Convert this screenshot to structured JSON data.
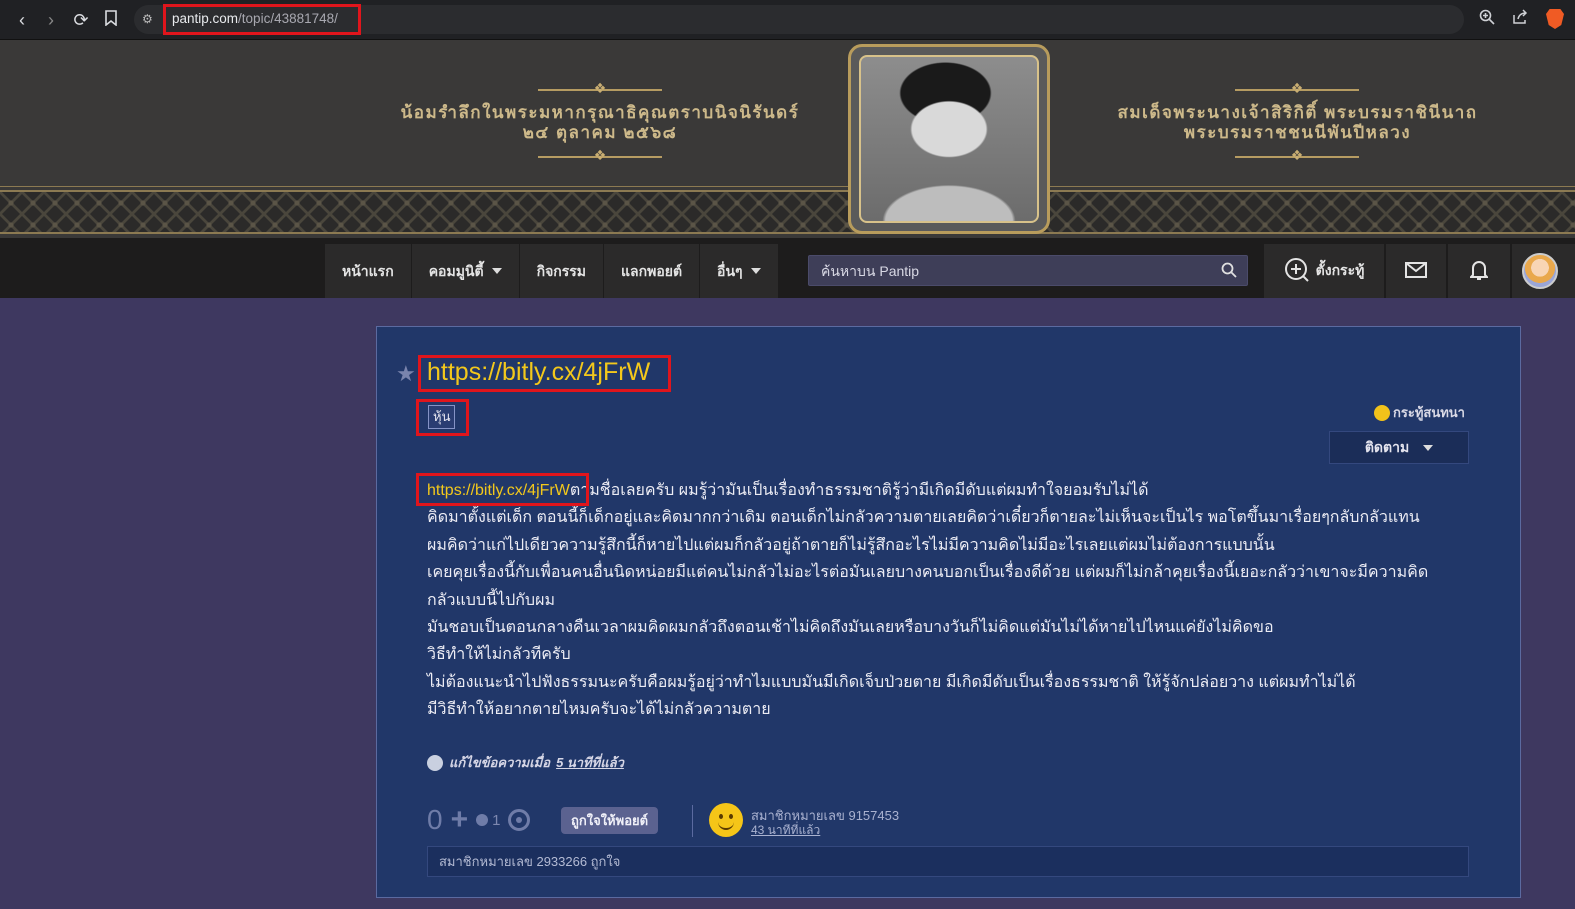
{
  "browser": {
    "url_host": "pantip.com",
    "url_path": "/topic/43881748/"
  },
  "banner": {
    "left_line1": "น้อมรำลึกในพระมหากรุณาธิคุณตราบนิจนิรันดร์",
    "left_line2": "๒๔ ตุลาคม ๒๕๖๘",
    "right_line1": "สมเด็จพระนางเจ้าสิริกิติ์ พระบรมราชินีนาถ",
    "right_line2": "พระบรมราชชนนีพันปีหลวง"
  },
  "nav": {
    "home": "หน้าแรก",
    "community": "คอมมูนิตี้",
    "activities": "กิจกรรม",
    "points": "แลกพอยต์",
    "more": "อื่นๆ",
    "search_placeholder": "ค้นหาบน Pantip",
    "new_topic": "ตั้งกระทู้"
  },
  "topic": {
    "title": "https://bitly.cx/4jFrW",
    "tag": "หุ้น",
    "type": "กระทู้สนทนา",
    "follow": "ติดตาม",
    "body_link": "https://bitly.cx/4jFrW",
    "body_line1_rest": "ตามชื่อเลยครับ ผมรู้ว่ามันเป็นเรื่องทำธรรมชาติรู้ว่ามีเกิดมีดับแต่ผมทำใจยอมรับไม่ได้",
    "body_lines": [
      "คิดมาตั้งแต่เด็ก ตอนนี้ก็เด็กอยู่และคิดมากกว่าเดิม ตอนเด็กไม่กลัวความตายเลยคิดว่าเดี๋ยวก็ตายละไม่เห็นจะเป็นไร พอโตขึ้นมาเรื่อยๆกลับกลัวแทน",
      "ผมคิดว่าแก่ไปเดียวความรู้สึกนี้ก็หายไปแต่ผมก็กลัวอยู่ถ้าตายก็ไม่รู้สึกอะไรไม่มีความคิดไม่มีอะไรเลยแต่ผมไม่ต้องการแบบนั้น",
      "เคยคุยเรื่องนี้กับเพื่อนคนอื่นนิดหน่อยมีแต่คนไม่กลัวไม่อะไรต่อมันเลยบางคนบอกเป็นเรื่องดีด้วย แต่ผมก็ไม่กล้าคุยเรื่องนี้เยอะกลัวว่าเขาจะมีความคิด",
      "กลัวแบบนี้ไปกับผม",
      "มันชอบเป็นตอนกลางคืนเวลาผมคิดผมกลัวถึงตอนเช้าไม่คิดถึงมันเลยหรือบางวันก็ไม่คิดแต่มันไม่ได้หายไปไหนแค่ยังไม่คิดขอ",
      "วิธีทำให้ไม่กลัวทีครับ",
      "ไม่ต้องแนะนำไปฟังธรรมนะครับคือผมรู้อยู่ว่าทำไมแบบมันมีเกิดเจ็บป่วยตาย มีเกิดมีดับเป็นเรื่องธรรมชาติ ให้รู้จักปล่อยวาง แต่ผมทำไม่ได้",
      "มีวิธีทำให้อยากตายไหมครับจะได้ไม่กลัวความตาย"
    ],
    "edit_prefix": "แก้ไขข้อความเมื่อ",
    "edit_time": "5 นาทีที่แล้ว",
    "score": "0",
    "emotion_count": "1",
    "like_button": "ถูกใจให้พอยต์",
    "author": "สมาชิกหมายเลข 9157453",
    "post_time": "43 นาทีที่แล้ว",
    "likers": "สมาชิกหมายเลข 2933266 ถูกใจ"
  }
}
